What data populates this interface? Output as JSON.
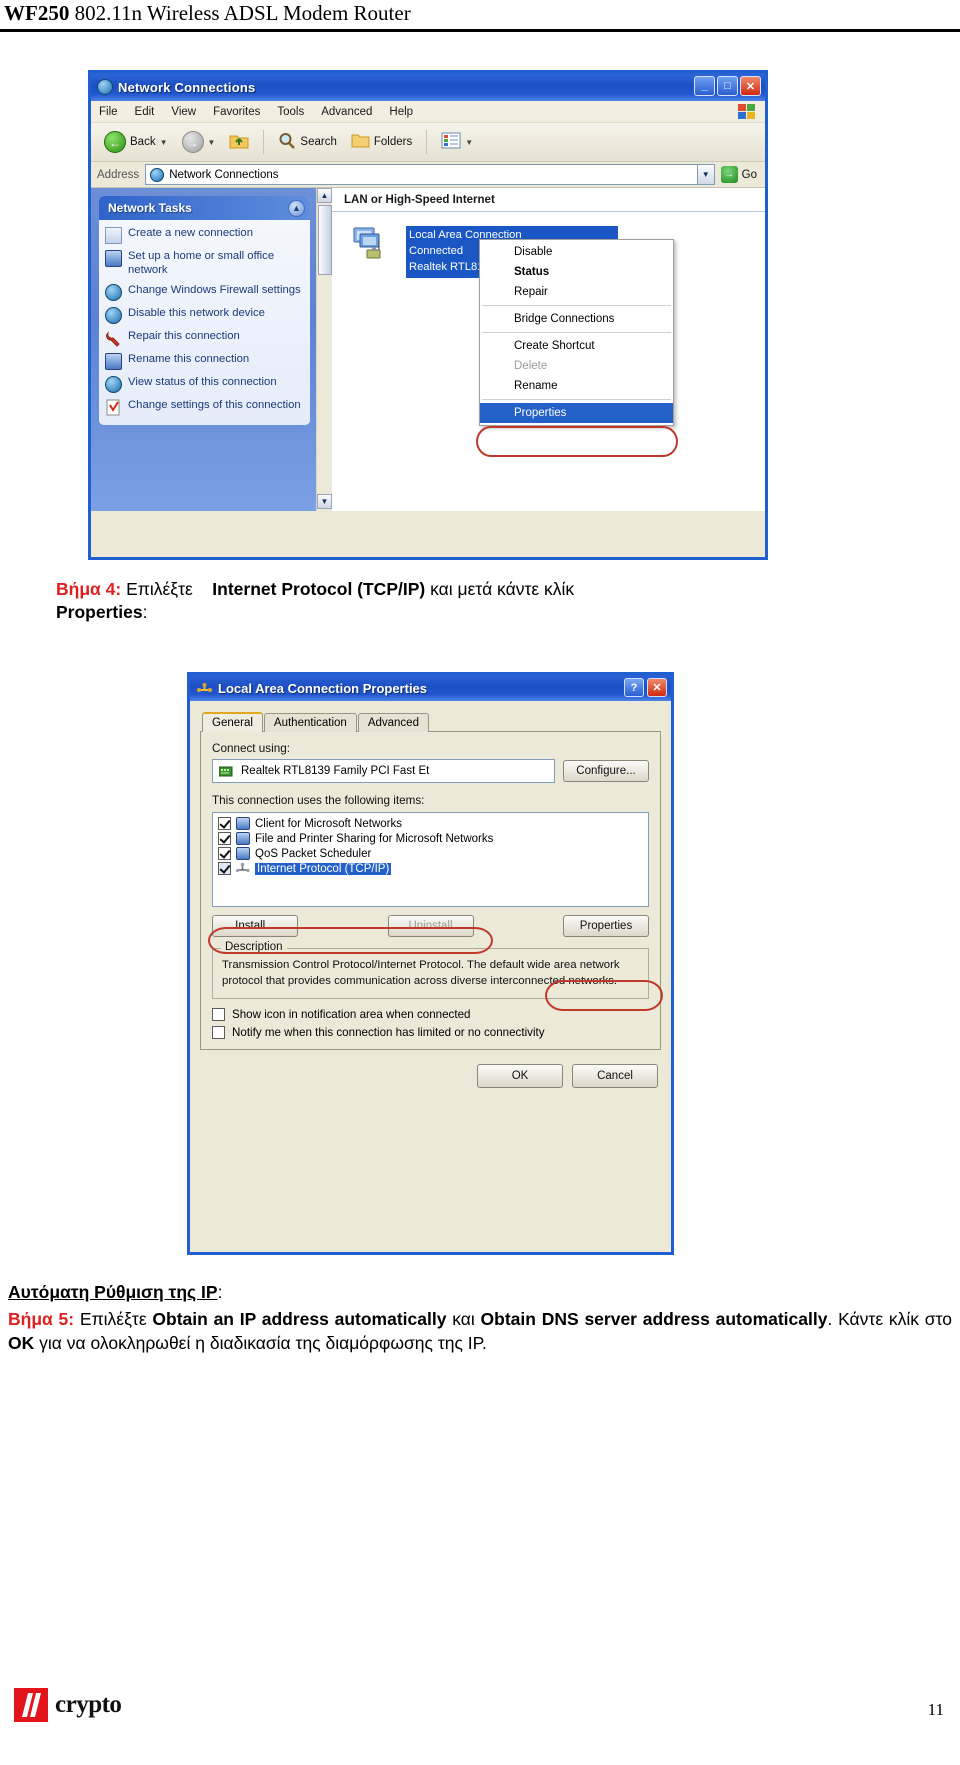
{
  "header": {
    "model": "WF250",
    "subtitle": "802.11n Wireless ADSL Modem Router"
  },
  "screenshot1": {
    "name": "network-connections-window",
    "title": "Network Connections",
    "window_buttons": {
      "minimize": "_",
      "maximize": "□",
      "close": "✕"
    },
    "menu": [
      "File",
      "Edit",
      "View",
      "Favorites",
      "Tools",
      "Advanced",
      "Help"
    ],
    "toolbar": {
      "back": "Back",
      "search": "Search",
      "folders": "Folders"
    },
    "address": {
      "label": "Address",
      "value": "Network Connections",
      "go": "Go"
    },
    "sidebar": {
      "panel_title": "Network Tasks",
      "items": [
        "Create a new connection",
        "Set up a home or small office network",
        "Change Windows Firewall settings",
        "Disable this network device",
        "Repair this connection",
        "Rename this connection",
        "View status of this connection",
        "Change settings of this connection"
      ]
    },
    "list": {
      "group_header": "LAN or High-Speed Internet",
      "connection": {
        "name": "Local Area Connection",
        "status": "Connected",
        "device": "Realtek RTL8139 Family PCI F…"
      }
    },
    "context_menu": {
      "items": [
        {
          "label": "Disable",
          "state": "normal"
        },
        {
          "label": "Status",
          "state": "bold"
        },
        {
          "label": "Repair",
          "state": "normal"
        },
        {
          "label": "Bridge Connections",
          "state": "normal"
        },
        {
          "label": "Create Shortcut",
          "state": "normal"
        },
        {
          "label": "Delete",
          "state": "disabled"
        },
        {
          "label": "Rename",
          "state": "normal"
        },
        {
          "label": "Properties",
          "state": "selected"
        }
      ]
    }
  },
  "step4": {
    "label": "Βήμα 4:",
    "text_1": "Επιλέξτε",
    "bold_1": "Internet Protocol (TCP/IP)",
    "text_2": "και  μετά  κάντε  κλίκ",
    "bold_2": "Properties",
    "text_3": ":"
  },
  "screenshot2": {
    "name": "local-area-connection-properties-dialog",
    "title": "Local Area Connection Properties",
    "buttons": {
      "help": "?",
      "close": "✕"
    },
    "tabs": [
      {
        "label": "General",
        "active": true
      },
      {
        "label": "Authentication",
        "active": false
      },
      {
        "label": "Advanced",
        "active": false
      }
    ],
    "connect_using": {
      "label": "Connect using:",
      "adapter": "Realtek RTL8139 Family PCI Fast Et",
      "configure_button": "Configure..."
    },
    "items_list": {
      "label": "This connection uses the following items:",
      "items": [
        {
          "label": "Client for Microsoft Networks",
          "checked": true,
          "selected": false
        },
        {
          "label": "File and Printer Sharing for Microsoft Networks",
          "checked": true,
          "selected": false
        },
        {
          "label": "QoS Packet Scheduler",
          "checked": true,
          "selected": false
        },
        {
          "label": "Internet Protocol (TCP/IP)",
          "checked": true,
          "selected": true
        }
      ]
    },
    "action_buttons": {
      "install": "Install...",
      "uninstall": "Uninstall",
      "properties": "Properties"
    },
    "description": {
      "legend": "Description",
      "text": "Transmission Control Protocol/Internet Protocol. The default wide area network protocol that provides communication across diverse interconnected networks."
    },
    "checkboxes": [
      {
        "label": "Show icon in notification area when connected",
        "checked": false
      },
      {
        "label": "Notify me when this connection has limited or no connectivity",
        "checked": false
      }
    ],
    "footer_buttons": {
      "ok": "OK",
      "cancel": "Cancel"
    }
  },
  "auto_ip": {
    "heading": "Αυτόματη Ρύθμιση της IP",
    "heading_colon": ":",
    "step_label": "Βήμα 5:",
    "line1_a": "Επιλέξτε",
    "line1_bold1": "Obtain an IP address automatically",
    "line1_b": "και",
    "line1_bold2": "Obtain DNS",
    "line2_bold": "server address automatically",
    "line2_a": ". Κάντε  κλίκ  στο",
    "line2_bold2": "OK",
    "line2_b": "για  να  ολοκληρωθεί  η",
    "line3": "διαδικασία  της  διαμόρφωσης  της  IP."
  },
  "footer": {
    "logo_text": "crypto",
    "page_number": "11"
  },
  "colors": {
    "accent_red": "#e02020",
    "xp_blue": "#2b62d4",
    "selection_blue": "#2360c8",
    "ring_red": "#c0392b"
  }
}
